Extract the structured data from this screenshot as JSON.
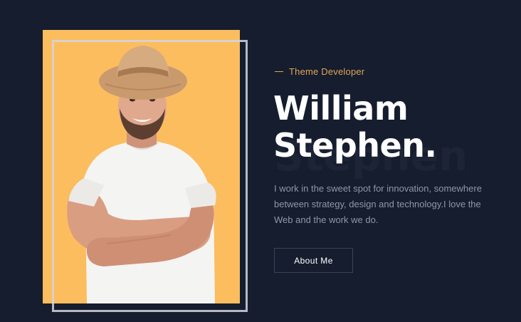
{
  "hero": {
    "tagline": "Theme Developer",
    "name_line1": "William",
    "name_line2": "Stephen.",
    "ghost_text": "Stephen",
    "description": "I work in the sweet spot for innovation, somewhere between strategy, design and technology.I love the Web and the work we do.",
    "button_label": "About Me"
  },
  "colors": {
    "background": "#151d2e",
    "accent": "#e3a457",
    "photo_background": "#fcbd5f"
  },
  "image": {
    "subject": "smiling man in straw hat and white t-shirt with crossed arms"
  }
}
